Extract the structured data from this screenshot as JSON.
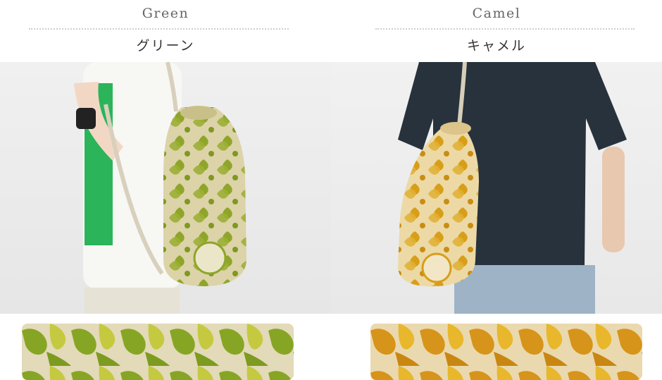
{
  "variants": [
    {
      "name_en": "Green",
      "name_jp": "グリーン",
      "icon": "green-drawstring-bag-photo",
      "colors": {
        "pattern": "#8da72a",
        "base": "#e3d9b6"
      }
    },
    {
      "name_en": "Camel",
      "name_jp": "キャメル",
      "icon": "camel-drawstring-bag-photo",
      "colors": {
        "pattern": "#d59f1c",
        "base": "#ead9b0"
      }
    }
  ]
}
